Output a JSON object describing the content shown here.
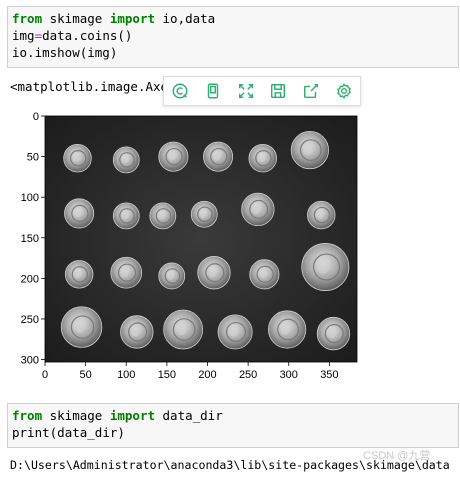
{
  "cell1": {
    "line1": {
      "kw1": "from",
      "t1": " skimage ",
      "kw2": "import",
      "t2": " io,data"
    },
    "line2": {
      "t1": "img",
      "op": "=",
      "t2": "data.coins()"
    },
    "line3": "io.imshow(img)"
  },
  "output1": "<matplotlib.image.Axes",
  "toolbar": {
    "icons": [
      "copy-circle-icon",
      "document-icon",
      "expand-icon",
      "save-icon",
      "share-icon",
      "settings-icon"
    ],
    "color": "#2eae6f"
  },
  "chart_data": {
    "type": "image",
    "image_name": "coins",
    "x_ticks": [
      "0",
      "50",
      "100",
      "150",
      "200",
      "250",
      "300",
      "350"
    ],
    "y_ticks": [
      "0",
      "50",
      "100",
      "150",
      "200",
      "250",
      "300"
    ],
    "xlim": [
      0,
      384
    ],
    "ylim": [
      303,
      0
    ],
    "coins": [
      {
        "x": 40,
        "y": 52,
        "r": 17
      },
      {
        "x": 100,
        "y": 54,
        "r": 16
      },
      {
        "x": 158,
        "y": 50,
        "r": 18
      },
      {
        "x": 213,
        "y": 50,
        "r": 18
      },
      {
        "x": 268,
        "y": 52,
        "r": 17
      },
      {
        "x": 326,
        "y": 42,
        "r": 23
      },
      {
        "x": 42,
        "y": 120,
        "r": 18
      },
      {
        "x": 100,
        "y": 123,
        "r": 16
      },
      {
        "x": 145,
        "y": 123,
        "r": 16
      },
      {
        "x": 196,
        "y": 121,
        "r": 16
      },
      {
        "x": 262,
        "y": 115,
        "r": 20
      },
      {
        "x": 340,
        "y": 122,
        "r": 17
      },
      {
        "x": 42,
        "y": 195,
        "r": 17
      },
      {
        "x": 100,
        "y": 193,
        "r": 19
      },
      {
        "x": 156,
        "y": 197,
        "r": 16
      },
      {
        "x": 208,
        "y": 193,
        "r": 20
      },
      {
        "x": 270,
        "y": 195,
        "r": 18
      },
      {
        "x": 345,
        "y": 186,
        "r": 29
      },
      {
        "x": 45,
        "y": 260,
        "r": 25
      },
      {
        "x": 113,
        "y": 266,
        "r": 20
      },
      {
        "x": 170,
        "y": 263,
        "r": 24
      },
      {
        "x": 234,
        "y": 266,
        "r": 21
      },
      {
        "x": 298,
        "y": 263,
        "r": 23
      },
      {
        "x": 355,
        "y": 268,
        "r": 20
      }
    ]
  },
  "cell2": {
    "line1": {
      "kw1": "from",
      "t1": " skimage ",
      "kw2": "import",
      "t2": " data_dir"
    },
    "line2": {
      "fn": "print",
      "t1": "(data_dir)"
    }
  },
  "output2": "D:\\Users\\Administrator\\anaconda3\\lib\\site-packages\\skimage\\data",
  "watermark": "CSDN @九营"
}
